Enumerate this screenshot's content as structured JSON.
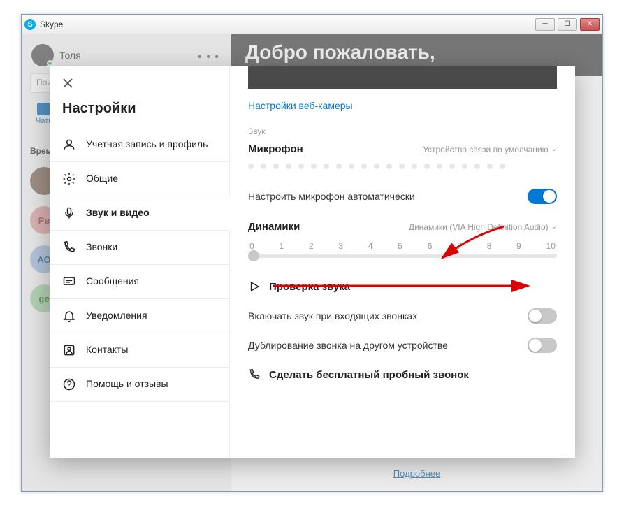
{
  "window": {
    "title": "Skype"
  },
  "bg": {
    "username": "Толя",
    "more": "• • •",
    "search_placeholder": "Пои",
    "tab_chats": "Чаты",
    "time_label": "Время",
    "header": "Добро пожаловать,",
    "more_link": "Подробнее",
    "contacts": {
      "c2": "Рв",
      "c3": "АО",
      "c4": "ge"
    }
  },
  "settings": {
    "title": "Настройки",
    "items": [
      {
        "label": "Учетная запись и профиль"
      },
      {
        "label": "Общие"
      },
      {
        "label": "Звук и видео"
      },
      {
        "label": "Звонки"
      },
      {
        "label": "Сообщения"
      },
      {
        "label": "Уведомления"
      },
      {
        "label": "Контакты"
      },
      {
        "label": "Помощь и отзывы"
      }
    ]
  },
  "content": {
    "webcam_link": "Настройки веб-камеры",
    "sound_label": "Звук",
    "microphone": {
      "title": "Микрофон",
      "value": "Устройство связи по умолчанию"
    },
    "auto_mic": "Настроить микрофон автоматически",
    "speakers": {
      "title": "Динамики",
      "value": "Динамики (VIA High Definition Audio)"
    },
    "slider": {
      "ticks": [
        "0",
        "1",
        "2",
        "3",
        "4",
        "5",
        "6",
        "7",
        "8",
        "9",
        "10"
      ]
    },
    "test_sound": "Проверка звука",
    "incoming_sound": "Включать звук при входящих звонках",
    "duplicate_ring": "Дублирование звонка на другом устройстве",
    "free_call": "Сделать бесплатный пробный звонок"
  }
}
